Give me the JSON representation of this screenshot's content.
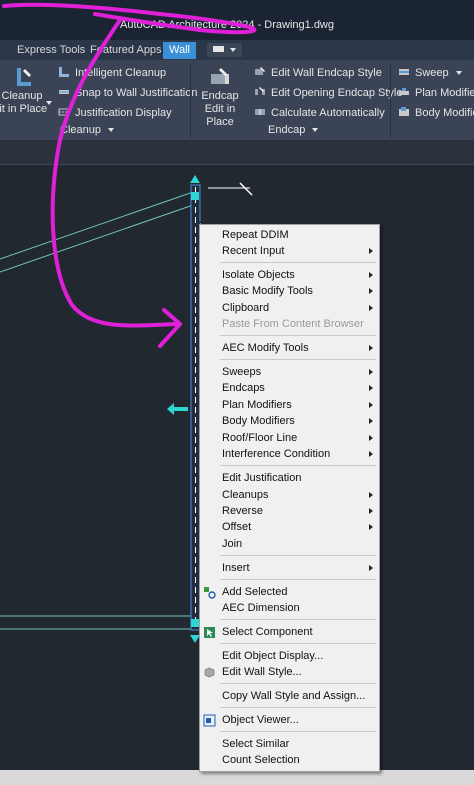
{
  "app": {
    "title": "AutoCAD Architecture 2024 - Drawing1.dwg"
  },
  "tabs": [
    {
      "label": "Express Tools"
    },
    {
      "label": "Featured Apps"
    },
    {
      "label": "Wall"
    }
  ],
  "ribbon": {
    "cleanup_panel": {
      "big_button_line1": "Cleanup",
      "big_button_line2": "lit in Place",
      "items": [
        "Intelligent Cleanup",
        "Snap to Wall Justification",
        "Justification Display"
      ],
      "label": "Cleanup"
    },
    "endcap_panel": {
      "big_button_line1": "Endcap",
      "big_button_line2": "Edit in Place",
      "items": [
        "Edit Wall Endcap Style",
        "Edit Opening Endcap Style",
        "Calculate Automatically"
      ],
      "label": "Endcap"
    },
    "right_panel": {
      "items": [
        "Sweep",
        "Plan Modifier",
        "Body Modifier"
      ]
    }
  },
  "context_menu": {
    "items": [
      {
        "label": "Repeat DDIM",
        "submenu": false
      },
      {
        "label": "Recent Input",
        "submenu": true
      },
      {
        "label": "Isolate Objects",
        "submenu": true
      },
      {
        "label": "Basic Modify Tools",
        "submenu": true
      },
      {
        "label": "Clipboard",
        "submenu": true
      },
      {
        "label": "Paste From Content Browser",
        "submenu": false,
        "disabled": true
      },
      {
        "label": "AEC Modify Tools",
        "submenu": true
      },
      {
        "label": "Sweeps",
        "submenu": true
      },
      {
        "label": "Endcaps",
        "submenu": true
      },
      {
        "label": "Plan Modifiers",
        "submenu": true
      },
      {
        "label": "Body Modifiers",
        "submenu": true
      },
      {
        "label": "Roof/Floor Line",
        "submenu": true
      },
      {
        "label": "Interference Condition",
        "submenu": true
      },
      {
        "label": "Edit Justification",
        "submenu": false
      },
      {
        "label": "Cleanups",
        "submenu": true
      },
      {
        "label": "Reverse",
        "submenu": true
      },
      {
        "label": "Offset",
        "submenu": true
      },
      {
        "label": "Join",
        "submenu": false
      },
      {
        "label": "Insert",
        "submenu": true
      },
      {
        "label": "Add Selected",
        "submenu": false,
        "icon": "add-selected-icon"
      },
      {
        "label": "AEC Dimension",
        "submenu": false
      },
      {
        "label": "Select Component",
        "submenu": false,
        "icon": "select-component-icon"
      },
      {
        "label": "Edit Object Display...",
        "submenu": false
      },
      {
        "label": "Edit Wall Style...",
        "submenu": false,
        "icon": "wall-style-icon"
      },
      {
        "label": "Copy Wall Style and Assign...",
        "submenu": false
      },
      {
        "label": "Object Viewer...",
        "submenu": false,
        "icon": "object-viewer-icon"
      },
      {
        "label": "Select Similar",
        "submenu": false
      },
      {
        "label": "Count Selection",
        "submenu": false
      }
    ]
  },
  "colors": {
    "accent_tab": "#3a8fd6",
    "annotation": "#e020d8",
    "grip": "#2fd6d6",
    "wall_line": "#6fc3b8"
  }
}
